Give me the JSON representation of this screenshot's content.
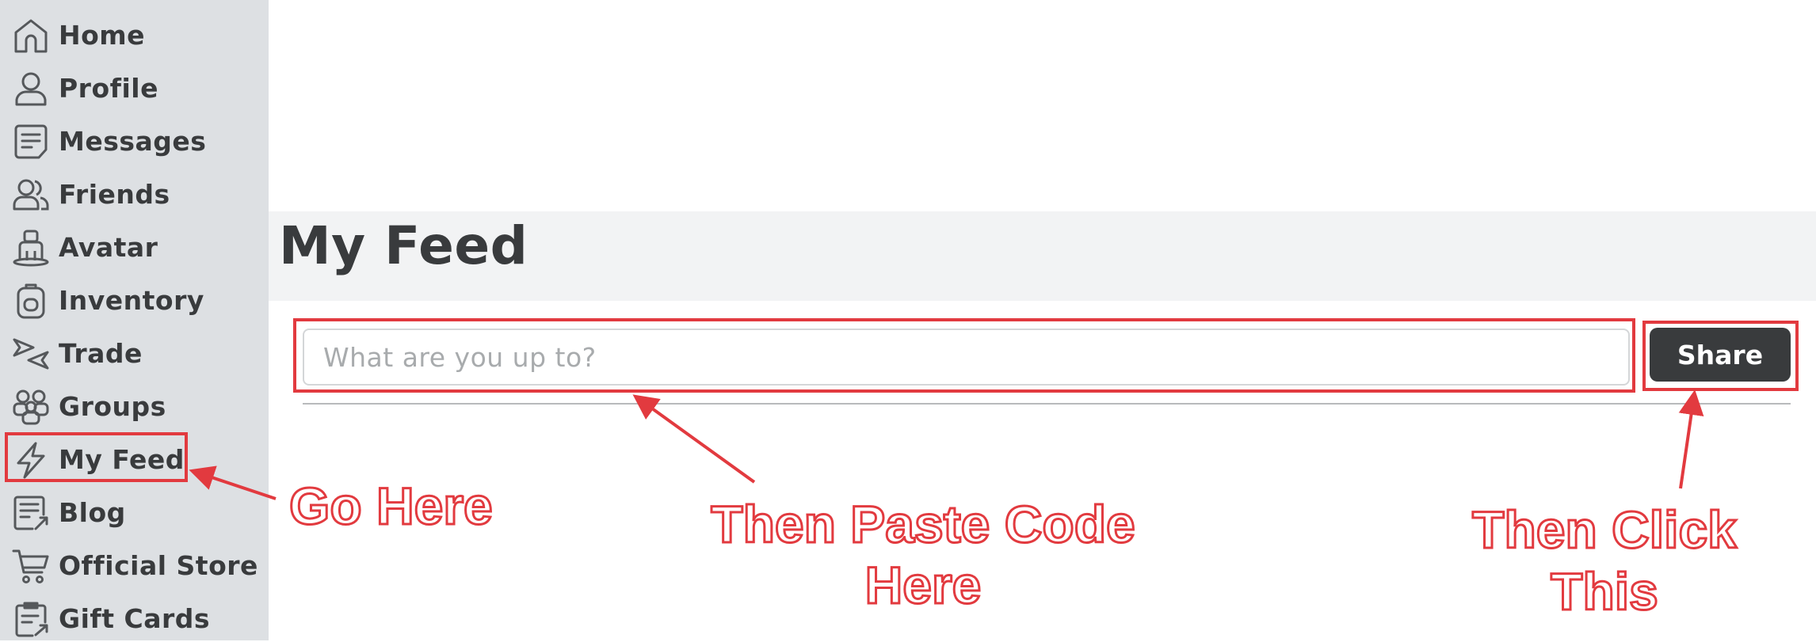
{
  "sidebar": {
    "items": [
      {
        "label": "Home",
        "icon": "home-icon"
      },
      {
        "label": "Profile",
        "icon": "profile-icon"
      },
      {
        "label": "Messages",
        "icon": "messages-icon"
      },
      {
        "label": "Friends",
        "icon": "friends-icon"
      },
      {
        "label": "Avatar",
        "icon": "avatar-icon"
      },
      {
        "label": "Inventory",
        "icon": "inventory-icon"
      },
      {
        "label": "Trade",
        "icon": "trade-icon"
      },
      {
        "label": "Groups",
        "icon": "groups-icon"
      },
      {
        "label": "My Feed",
        "icon": "lightning-icon"
      },
      {
        "label": "Blog",
        "icon": "blog-icon"
      },
      {
        "label": "Official Store",
        "icon": "cart-icon"
      },
      {
        "label": "Gift Cards",
        "icon": "gift-card-icon"
      }
    ]
  },
  "main": {
    "title": "My Feed",
    "composer": {
      "placeholder": "What are you up to?",
      "value": "",
      "share_label": "Share"
    }
  },
  "annotations": {
    "go_here": "Go Here",
    "paste_line1": "Then Paste Code",
    "paste_line2": "Here",
    "click_line1": "Then Click",
    "click_line2": "This"
  },
  "colors": {
    "sidebar_bg": "#dde0e3",
    "header_bg": "#f2f3f4",
    "text_dark": "#393b3d",
    "button_bg": "#393b3d",
    "annotation_red": "#e23a3f"
  }
}
